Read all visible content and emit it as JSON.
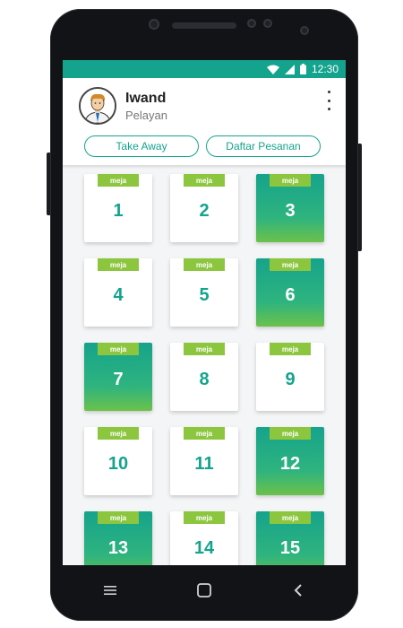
{
  "status": {
    "time": "12:30",
    "icons": [
      "wifi-icon",
      "signal-icon",
      "battery-icon"
    ],
    "color": "#14a38d"
  },
  "profile": {
    "name": "Iwand",
    "role": "Pelayan",
    "avatar_icon": "avatar-icon",
    "menu_icon": "more-vertical-icon"
  },
  "actions": [
    {
      "label": "Take Away"
    },
    {
      "label": "Daftar Pesanan"
    }
  ],
  "tables": [
    {
      "tag": "meja",
      "number": "1",
      "active": false
    },
    {
      "tag": "meja",
      "number": "2",
      "active": false
    },
    {
      "tag": "meja",
      "number": "3",
      "active": true
    },
    {
      "tag": "meja",
      "number": "4",
      "active": false
    },
    {
      "tag": "meja",
      "number": "5",
      "active": false
    },
    {
      "tag": "meja",
      "number": "6",
      "active": true
    },
    {
      "tag": "meja",
      "number": "7",
      "active": true
    },
    {
      "tag": "meja",
      "number": "8",
      "active": false
    },
    {
      "tag": "meja",
      "number": "9",
      "active": false
    },
    {
      "tag": "meja",
      "number": "10",
      "active": false
    },
    {
      "tag": "meja",
      "number": "11",
      "active": false
    },
    {
      "tag": "meja",
      "number": "12",
      "active": true
    },
    {
      "tag": "meja",
      "number": "13",
      "active": true
    },
    {
      "tag": "meja",
      "number": "14",
      "active": false
    },
    {
      "tag": "meja",
      "number": "15",
      "active": true
    }
  ],
  "navbar": {
    "icons": [
      "menu-icon",
      "home-icon",
      "back-icon"
    ]
  },
  "colors": {
    "accent": "#14a38d",
    "tag": "#8cc63f",
    "active_gradient_end": "#6cc14a"
  }
}
